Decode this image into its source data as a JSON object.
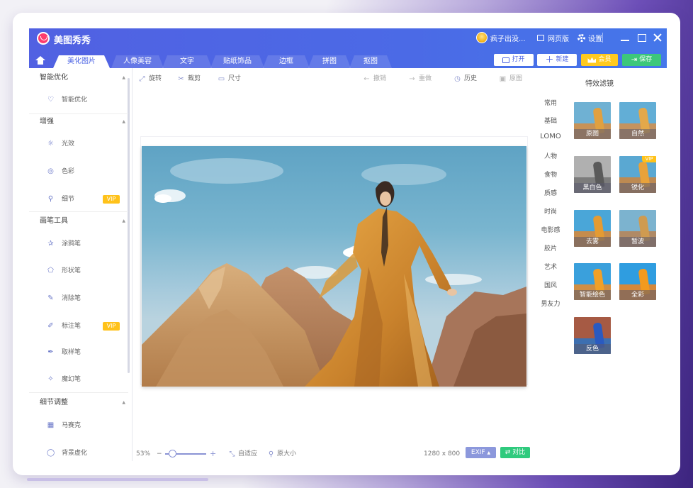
{
  "app": {
    "title": "美图秀秀",
    "user_name": "疯子出没...",
    "web_version": "网页版",
    "settings": "设置"
  },
  "tabs": [
    {
      "label": "美化图片",
      "active": true
    },
    {
      "label": "人像美容"
    },
    {
      "label": "文字"
    },
    {
      "label": "贴纸饰品"
    },
    {
      "label": "边框"
    },
    {
      "label": "拼图"
    },
    {
      "label": "抠图"
    }
  ],
  "header_buttons": {
    "open": "打开",
    "new": "新建",
    "vip": "会员",
    "save": "保存"
  },
  "left_panel": {
    "sections": [
      {
        "title": "智能优化",
        "items": [
          {
            "label": "智能优化",
            "icon": "smart-icon"
          }
        ]
      },
      {
        "title": "增强",
        "items": [
          {
            "label": "光效",
            "icon": "light-icon"
          },
          {
            "label": "色彩",
            "icon": "palette-icon"
          },
          {
            "label": "细节",
            "icon": "magnifier-icon",
            "vip": "VIP"
          }
        ]
      },
      {
        "title": "画笔工具",
        "items": [
          {
            "label": "涂鸦笔",
            "icon": "doodle-icon"
          },
          {
            "label": "形状笔",
            "icon": "shape-icon"
          },
          {
            "label": "消除笔",
            "icon": "eraser-icon"
          },
          {
            "label": "标注笔",
            "icon": "mark-pen-icon",
            "vip": "VIP"
          },
          {
            "label": "取样笔",
            "icon": "sampler-icon"
          },
          {
            "label": "魔幻笔",
            "icon": "magic-pen-icon"
          }
        ]
      },
      {
        "title": "细节调整",
        "items": [
          {
            "label": "马赛克",
            "icon": "mosaic-icon"
          },
          {
            "label": "背景虚化",
            "icon": "blur-icon"
          }
        ]
      }
    ]
  },
  "toolbar": {
    "rotate": "旋转",
    "crop": "裁剪",
    "size": "尺寸",
    "undo": "撤销",
    "redo": "重做",
    "history": "历史",
    "original": "原图"
  },
  "bottom_bar": {
    "zoom": "53%",
    "zoom_minus": "−",
    "zoom_plus": "+",
    "fit": "自适应",
    "actual_size": "原大小",
    "dimensions": "1280 x 800",
    "exif": "EXIF",
    "compare": "对比"
  },
  "right_panel": {
    "title": "特效滤镜",
    "categories": [
      "常用",
      "基础",
      "LOMO",
      "人物",
      "食物",
      "质感",
      "时尚",
      "电影感",
      "胶片",
      "艺术",
      "国风",
      "男友力"
    ],
    "filters": [
      {
        "label": "原图",
        "style": "original"
      },
      {
        "label": "自然",
        "style": "natural"
      },
      {
        "label": "黑白色",
        "style": "bw"
      },
      {
        "label": "锐化",
        "style": "sharpen",
        "vip": "VIP"
      },
      {
        "label": "去雾",
        "style": "dehaze"
      },
      {
        "label": "暂波",
        "style": "wave"
      },
      {
        "label": "智能绘色",
        "style": "smartcolor"
      },
      {
        "label": "全彩",
        "style": "fullcolor"
      },
      {
        "label": "反色",
        "style": "invert"
      }
    ]
  },
  "colors": {
    "titlebar": "#4b63e4",
    "vip": "#ffc21a",
    "save": "#3dc77a",
    "exif": "#8c98dc"
  }
}
